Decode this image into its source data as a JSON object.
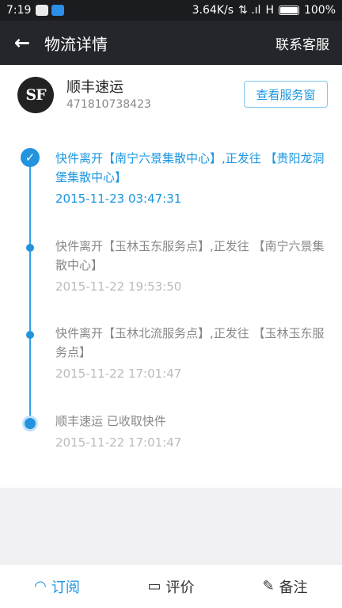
{
  "status": {
    "time": "7:19",
    "net_speed": "3.64K/s",
    "network": "H",
    "battery": "100%"
  },
  "header": {
    "title": "物流详情",
    "contact_label": "联系客服"
  },
  "courier": {
    "name": "顺丰速运",
    "tracking_number": "471810738423",
    "logo_text": "SF",
    "service_button": "查看服务窗"
  },
  "events": [
    {
      "desc": "快件离开【南宁六景集散中心】,正发往 【贵阳龙洞堡集散中心】",
      "time": "2015-11-23 03:47:31"
    },
    {
      "desc": "快件离开【玉林玉东服务点】,正发往 【南宁六景集散中心】",
      "time": "2015-11-22 19:53:50"
    },
    {
      "desc": "快件离开【玉林北流服务点】,正发往 【玉林玉东服务点】",
      "time": "2015-11-22 17:01:47"
    },
    {
      "desc": "顺丰速运 已收取快件",
      "time": "2015-11-22 17:01:47"
    }
  ],
  "bottom_tabs": [
    {
      "label": "订阅",
      "icon": "rss-icon"
    },
    {
      "label": "评价",
      "icon": "comment-icon"
    },
    {
      "label": "备注",
      "icon": "edit-icon"
    }
  ],
  "colors": {
    "accent": "#1b96e0",
    "header_bg": "#24262b"
  }
}
